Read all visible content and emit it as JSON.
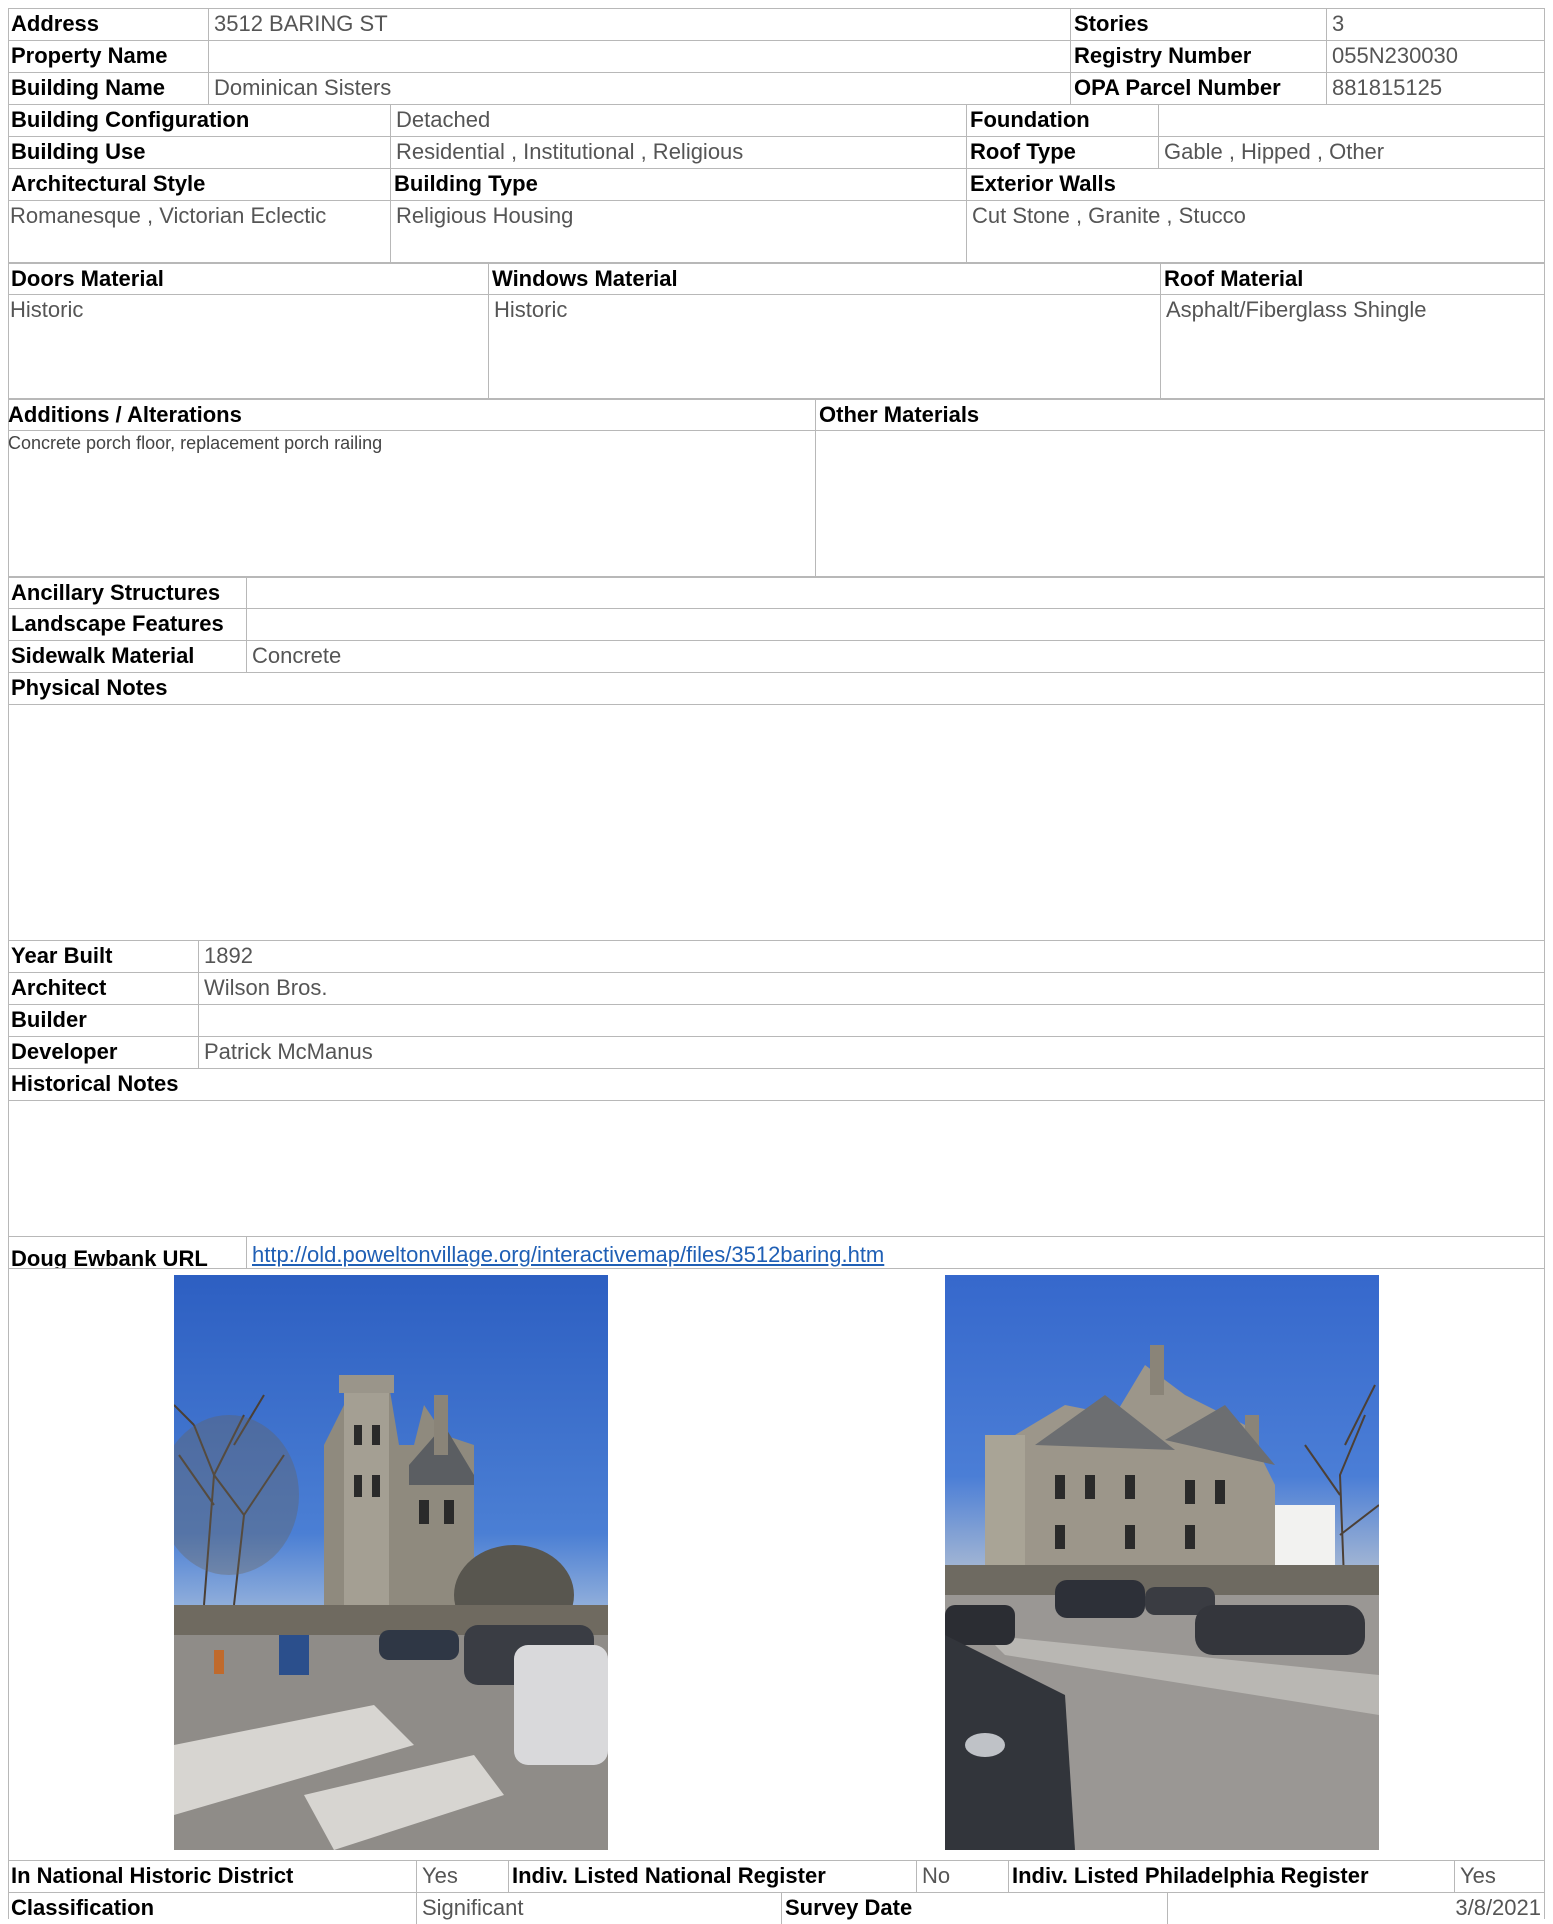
{
  "address": {
    "label": "Address",
    "value": "3512 BARING ST"
  },
  "stories": {
    "label": "Stories",
    "value": "3"
  },
  "property_name": {
    "label": "Property Name",
    "value": ""
  },
  "registry_number": {
    "label": "Registry Number",
    "value": "055N230030"
  },
  "building_name": {
    "label": "Building Name",
    "value": "Dominican Sisters"
  },
  "opa_parcel": {
    "label": "OPA Parcel Number",
    "value": "881815125"
  },
  "building_configuration": {
    "label": "Building Configuration",
    "value": "Detached"
  },
  "foundation": {
    "label": "Foundation",
    "value": ""
  },
  "building_use": {
    "label": "Building Use",
    "value": "Residential , Institutional , Religious"
  },
  "roof_type": {
    "label": "Roof Type",
    "value": "Gable , Hipped , Other"
  },
  "architectural_style": {
    "label": "Architectural Style",
    "value": "Romanesque , Victorian Eclectic"
  },
  "building_type": {
    "label": "Building Type",
    "value": "Religious Housing"
  },
  "exterior_walls": {
    "label": "Exterior Walls",
    "value": "Cut Stone , Granite , Stucco"
  },
  "doors_material": {
    "label": "Doors Material",
    "value": "Historic"
  },
  "windows_material": {
    "label": "Windows Material",
    "value": "Historic"
  },
  "roof_material": {
    "label": "Roof Material",
    "value": "Asphalt/Fiberglass Shingle"
  },
  "additions": {
    "label": "Additions / Alterations",
    "value": "Concrete porch floor, replacement porch railing"
  },
  "other_materials": {
    "label": "Other Materials",
    "value": ""
  },
  "ancillary": {
    "label": "Ancillary Structures",
    "value": ""
  },
  "landscape": {
    "label": "Landscape Features",
    "value": ""
  },
  "sidewalk": {
    "label": "Sidewalk Material",
    "value": "Concrete"
  },
  "physical_notes": {
    "label": "Physical Notes",
    "value": ""
  },
  "year_built": {
    "label": "Year Built",
    "value": "1892"
  },
  "architect": {
    "label": "Architect",
    "value": "Wilson Bros."
  },
  "builder": {
    "label": "Builder",
    "value": ""
  },
  "developer": {
    "label": "Developer",
    "value": "Patrick McManus"
  },
  "historical_notes": {
    "label": "Historical Notes",
    "value": ""
  },
  "ewbank": {
    "label": "Doug Ewbank URL",
    "value": "http://old.poweltonvillage.org/interactivemap/files/3512baring.htm"
  },
  "national_district": {
    "label": "In National Historic District",
    "value": "Yes"
  },
  "indiv_national": {
    "label": "Indiv. Listed National Register",
    "value": "No"
  },
  "indiv_phila": {
    "label": "Indiv. Listed Philadelphia Register",
    "value": "Yes"
  },
  "classification": {
    "label": "Classification",
    "value": "Significant"
  },
  "survey_date": {
    "label": "Survey Date",
    "value": "3/8/2021"
  }
}
